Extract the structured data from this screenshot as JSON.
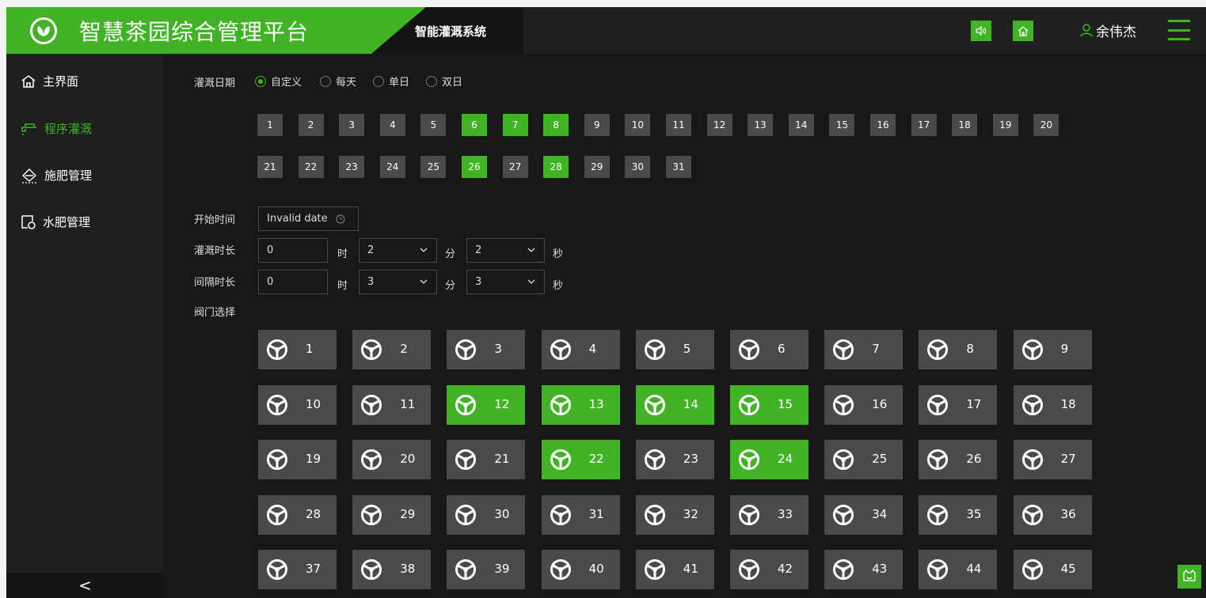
{
  "header": {
    "app_title": "智慧茶园综合管理平台",
    "subsystem_title": "智能灌溉系统",
    "user_name": "余伟杰",
    "icons": [
      "leaf-logo-icon",
      "sound-icon",
      "home-icon",
      "user-icon",
      "menu-icon"
    ]
  },
  "sidebar": {
    "items": [
      {
        "label": "主界面",
        "icon": "home-icon",
        "active": false
      },
      {
        "label": "程序灌溉",
        "icon": "faucet-icon",
        "active": true
      },
      {
        "label": "施肥管理",
        "icon": "fertilizer-icon",
        "active": false
      },
      {
        "label": "水肥管理",
        "icon": "water-fertilizer-icon",
        "active": false
      }
    ],
    "collapse_glyph": "<"
  },
  "form": {
    "date_label": "灌溉日期",
    "date_modes": [
      {
        "label": "自定义",
        "selected": true
      },
      {
        "label": "每天",
        "selected": false
      },
      {
        "label": "单日",
        "selected": false
      },
      {
        "label": "双日",
        "selected": false
      }
    ],
    "days": [
      "1",
      "2",
      "3",
      "4",
      "5",
      "6",
      "7",
      "8",
      "9",
      "10",
      "11",
      "12",
      "13",
      "14",
      "15",
      "16",
      "17",
      "18",
      "19",
      "20",
      "21",
      "22",
      "23",
      "24",
      "25",
      "26",
      "27",
      "28",
      "29",
      "30",
      "31"
    ],
    "selected_days": [
      "6",
      "7",
      "8",
      "26",
      "28"
    ],
    "start_label": "开始时间",
    "start_value": "Invalid date",
    "duration_label": "灌溉时长",
    "duration": {
      "hours": "0",
      "minutes": "2",
      "seconds": "2"
    },
    "interval_label": "间隔时长",
    "interval": {
      "hours": "0",
      "minutes": "3",
      "seconds": "3"
    },
    "unit_hour": "时",
    "unit_minute": "分",
    "unit_second": "秒",
    "valve_label": "阀门选择"
  },
  "valves": {
    "items": [
      "1",
      "2",
      "3",
      "4",
      "5",
      "6",
      "7",
      "8",
      "9",
      "10",
      "11",
      "12",
      "13",
      "14",
      "15",
      "16",
      "17",
      "18",
      "19",
      "20",
      "21",
      "22",
      "23",
      "24",
      "25",
      "26",
      "27",
      "28",
      "29",
      "30",
      "31",
      "32",
      "33",
      "34",
      "35",
      "36",
      "37",
      "38",
      "39",
      "40",
      "41",
      "42",
      "43",
      "44",
      "45"
    ],
    "selected": [
      "12",
      "13",
      "14",
      "15",
      "22",
      "24"
    ]
  },
  "colors": {
    "accent": "#42b226",
    "panel": "#181818",
    "sidebar": "#1e1f21",
    "tile": "#4a4a4a"
  }
}
